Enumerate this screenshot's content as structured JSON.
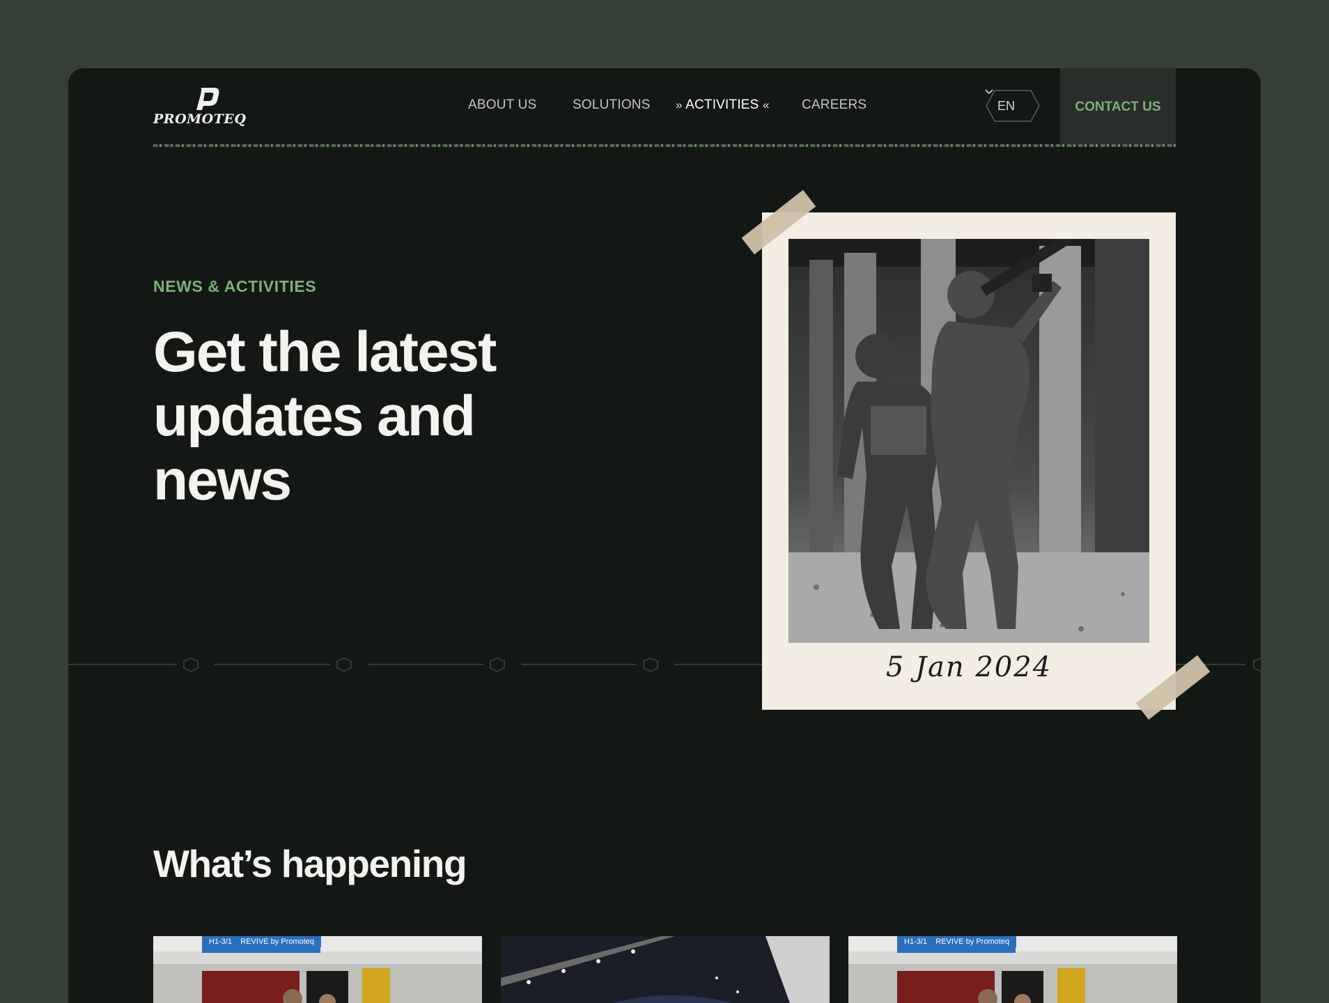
{
  "brand": {
    "name": "PROMOTEQ"
  },
  "nav": {
    "items": [
      {
        "label": "ABOUT US"
      },
      {
        "label": "SOLUTIONS"
      },
      {
        "label": "ACTIVITIES"
      },
      {
        "label": "CAREERS"
      }
    ],
    "language": "EN",
    "contact_label": "CONTACT US"
  },
  "hero": {
    "eyebrow": "NEWS & ACTIVITIES",
    "title": "Get the latest updates and news",
    "photo_caption": "5 Jan 2024"
  },
  "section": {
    "title": "What’s happening",
    "cards": [
      {
        "sign_code": "H1-3/1",
        "sign_text": "REVIVE by Promoteq"
      },
      {
        "sign_code": "",
        "sign_text": ""
      },
      {
        "sign_code": "H1-3/1",
        "sign_text": "REVIVE by Promoteq"
      }
    ]
  },
  "colors": {
    "background": "#364036",
    "window": "#141815",
    "accent_green": "#7fb07a",
    "polaroid": "#f3ede3"
  },
  "icons": [
    "logo-mark-icon",
    "double-chevron-right-icon",
    "double-chevron-left-icon",
    "chevron-down-icon",
    "hexagon-icon"
  ]
}
